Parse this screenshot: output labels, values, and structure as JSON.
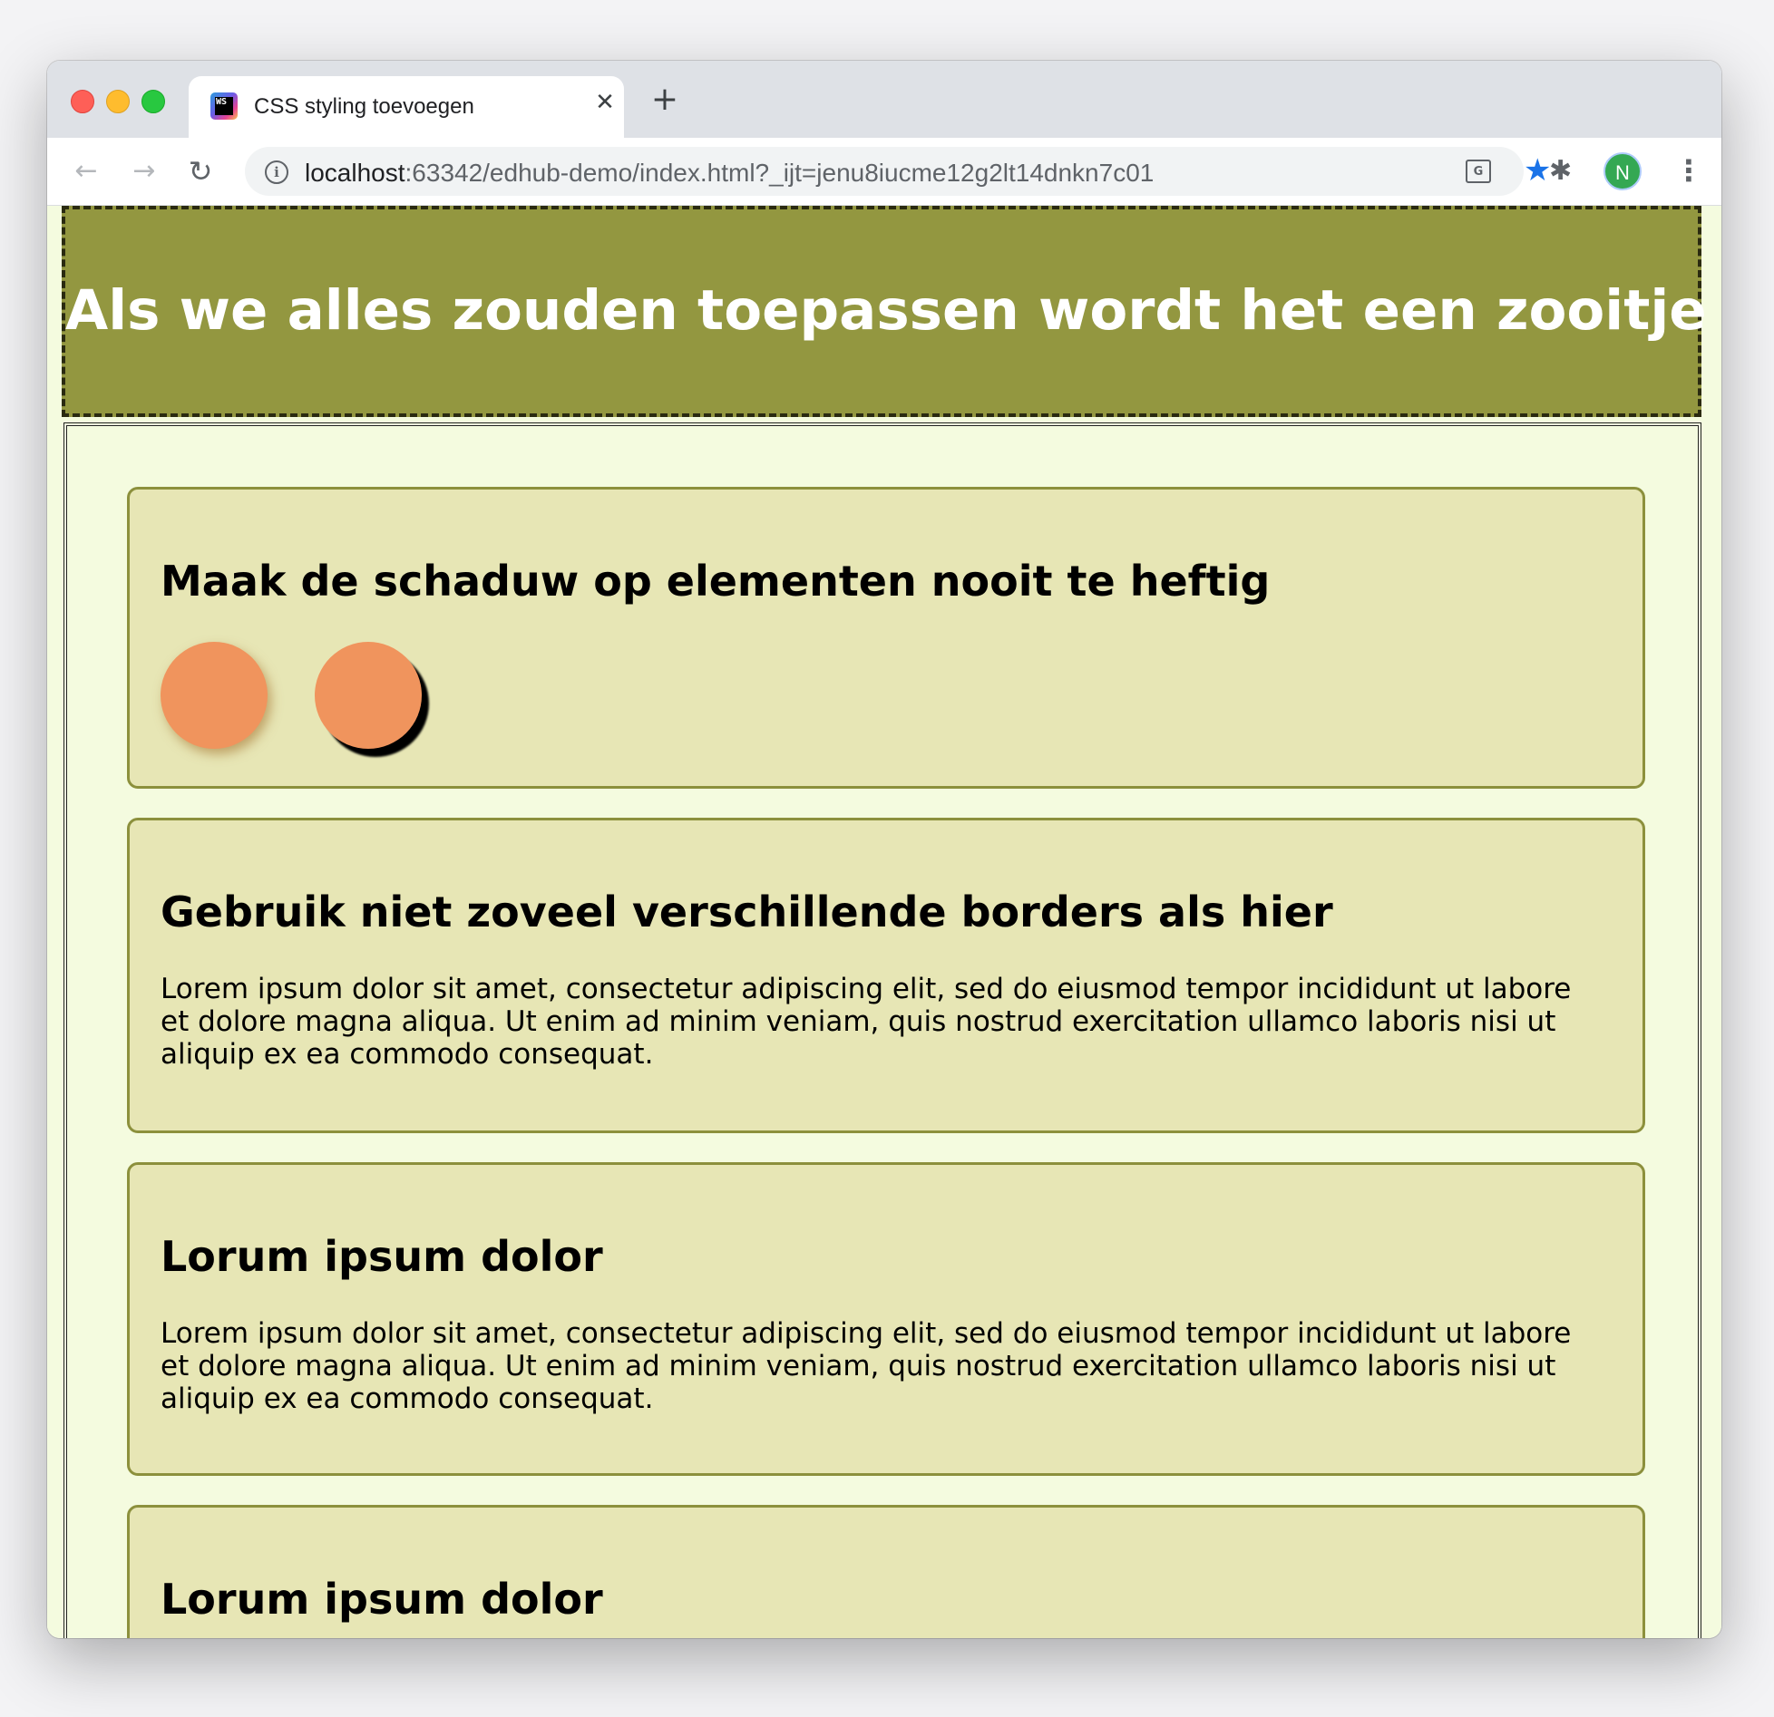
{
  "browser": {
    "tab": {
      "title": "CSS styling toevoegen",
      "icon": "ws-icon",
      "close_glyph": "✕"
    },
    "new_tab_glyph": "+",
    "nav": {
      "back_glyph": "←",
      "forward_glyph": "→",
      "reload_glyph": "↻"
    },
    "address": {
      "host": "localhost",
      "rest": ":63342/edhub-demo/index.html?_ijt=jenu8iucme12g2lt14dnkn7c01"
    },
    "profile_initial": "N",
    "bookmark_color": "#1a73e8"
  },
  "page": {
    "header_title": "Als we alles zouden toepassen wordt het een zooitje",
    "header_bg": "#939740",
    "cards": [
      {
        "title": "Maak de schaduw op elementen nooit te heftig",
        "circle_color": "#f0945d"
      },
      {
        "title": "Gebruik niet zoveel verschillende borders als hier",
        "text": "Lorem ipsum dolor sit amet, consectetur adipiscing elit, sed do eiusmod tempor incididunt ut labore et dolore magna aliqua. Ut enim ad minim veniam, quis nostrud exercitation ullamco laboris nisi ut aliquip ex ea commodo consequat."
      },
      {
        "title": "Lorum ipsum dolor",
        "text": "Lorem ipsum dolor sit amet, consectetur adipiscing elit, sed do eiusmod tempor incididunt ut labore et dolore magna aliqua. Ut enim ad minim veniam, quis nostrud exercitation ullamco laboris nisi ut aliquip ex ea commodo consequat."
      },
      {
        "title": "Lorum ipsum dolor"
      }
    ]
  }
}
